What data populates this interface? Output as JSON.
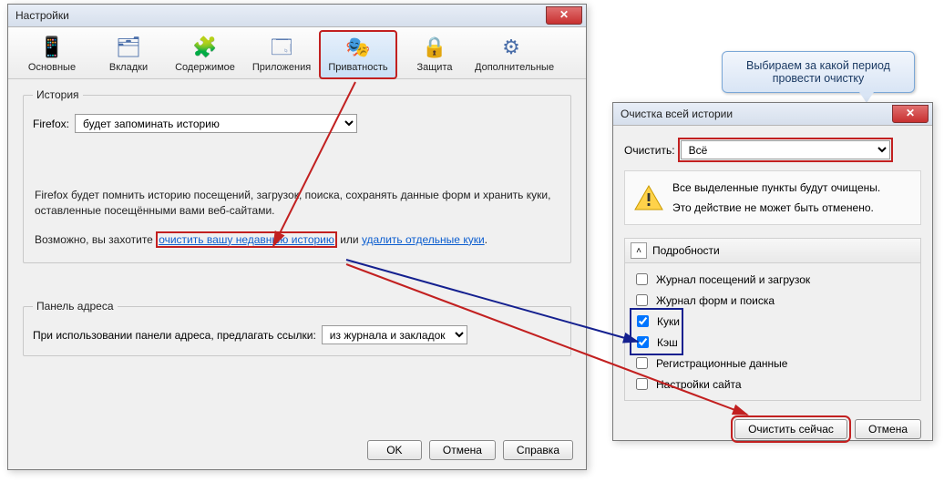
{
  "settings": {
    "title": "Настройки",
    "toolbar": [
      {
        "label": "Основные",
        "icon": "📱"
      },
      {
        "label": "Вкладки",
        "icon": "🗂"
      },
      {
        "label": "Содержимое",
        "icon": "🧩"
      },
      {
        "label": "Приложения",
        "icon": "🗔"
      },
      {
        "label": "Приватность",
        "icon": "🎭"
      },
      {
        "label": "Защита",
        "icon": "🔒"
      },
      {
        "label": "Дополнительные",
        "icon": "⚙"
      }
    ],
    "history_legend": "История",
    "firefox_label": "Firefox:",
    "history_mode": "будет запоминать историю",
    "desc1": "Firefox будет помнить историю посещений, загрузок, поиска, сохранять данные форм и хранить куки, оставленные посещёнными вами веб-сайтами.",
    "maybe_prefix": "Возможно, вы захотите ",
    "link_clear": "очистить вашу недавнюю историю",
    "or_text": " или ",
    "link_cookies": "удалить отдельные куки",
    "period": ".",
    "address_legend": "Панель адреса",
    "address_label": "При использовании панели адреса, предлагать ссылки:",
    "address_mode": "из журнала и закладок",
    "ok": "OK",
    "cancel": "Отмена",
    "help": "Справка"
  },
  "clear": {
    "title": "Очистка всей истории",
    "range_label": "Очистить:",
    "range_value": "Всё",
    "warn_line1": "Все выделенные пункты будут очищены.",
    "warn_line2": "Это действие не может быть отменено.",
    "details": "Подробности",
    "items": [
      {
        "label": "Журнал посещений и загрузок",
        "checked": false
      },
      {
        "label": "Журнал форм и поиска",
        "checked": false
      },
      {
        "label": "Куки",
        "checked": true
      },
      {
        "label": "Кэш",
        "checked": true
      },
      {
        "label": "Регистрационные данные",
        "checked": false
      },
      {
        "label": "Настройки сайта",
        "checked": false
      }
    ],
    "clear_now": "Очистить сейчас",
    "cancel": "Отмена"
  },
  "callout": "Выбираем за какой период провести очистку"
}
